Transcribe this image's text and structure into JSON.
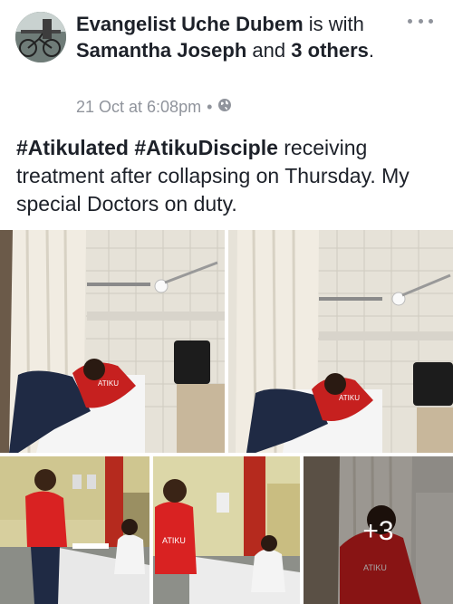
{
  "post": {
    "author": "Evangelist Uche Dubem",
    "is_with": "is with",
    "tagged_person": "Samantha Joseph",
    "and_word": "and",
    "others_count": "3",
    "others_word": "others",
    "period": ".",
    "timestamp": "21 Oct at 6:08pm",
    "separator": "•",
    "privacy_icon": "globe-icon",
    "more_icon": "more-options-icon",
    "hashtag1": "#Atikulated",
    "hashtag2": "#AtikuDisciple",
    "text_line": " receiving treatment after collapsing on Thursday. My special Doctors on duty."
  },
  "photos": {
    "more_count_label": "+3"
  }
}
